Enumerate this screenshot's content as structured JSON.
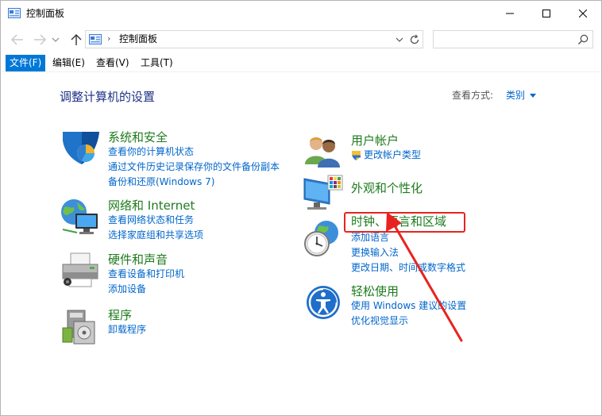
{
  "window": {
    "title": "控制面板"
  },
  "address": {
    "path_separator": "›",
    "path": "控制面板",
    "search_placeholder": ""
  },
  "menu": {
    "file": "文件(F)",
    "edit": "编辑(E)",
    "view": "查看(V)",
    "tools": "工具(T)"
  },
  "main": {
    "title": "调整计算机的设置",
    "view_by_label": "查看方式:",
    "view_by_value": "类别"
  },
  "categories": {
    "system": {
      "title": "系统和安全",
      "links": [
        "查看你的计算机状态",
        "通过文件历史记录保存你的文件备份副本",
        "备份和还原(Windows 7)"
      ]
    },
    "network": {
      "title": "网络和 Internet",
      "links": [
        "查看网络状态和任务",
        "选择家庭组和共享选项"
      ]
    },
    "hardware": {
      "title": "硬件和声音",
      "links": [
        "查看设备和打印机",
        "添加设备"
      ]
    },
    "programs": {
      "title": "程序",
      "links": [
        "卸载程序"
      ]
    },
    "users": {
      "title": "用户帐户",
      "links": [
        "更改帐户类型"
      ]
    },
    "appearance": {
      "title": "外观和个性化",
      "links": []
    },
    "clock": {
      "title": "时钟、语言和区域",
      "links": [
        "添加语言",
        "更换输入法",
        "更改日期、时间或数字格式"
      ]
    },
    "ease": {
      "title": "轻松使用",
      "links": [
        "使用 Windows 建议的设置",
        "优化视觉显示"
      ]
    }
  },
  "colors": {
    "accent": "#0078d7",
    "category_title": "#1e7b1e",
    "link": "#0066cc",
    "highlight": "#e8231f"
  },
  "icons": [
    "control-panel-icon",
    "minimize-icon",
    "maximize-icon",
    "close-icon",
    "back-arrow-icon",
    "forward-arrow-icon",
    "up-arrow-icon",
    "refresh-icon",
    "search-icon",
    "shield-icon",
    "network-globe-icon",
    "printer-icon",
    "programs-icon",
    "users-icon",
    "monitor-palette-icon",
    "clock-globe-icon",
    "ease-of-access-icon",
    "uac-shield-icon"
  ]
}
